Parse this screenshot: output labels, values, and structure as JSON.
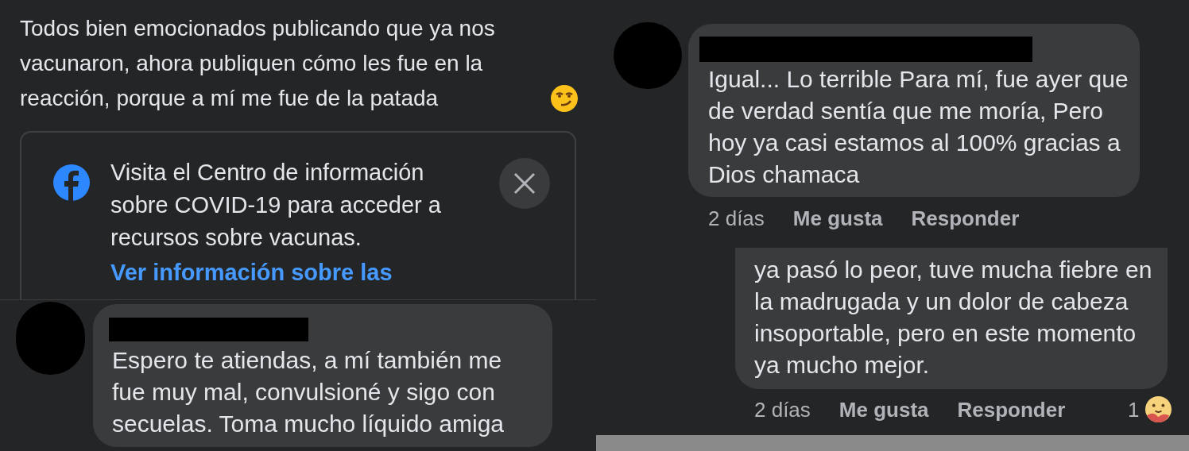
{
  "post": {
    "text": "Todos bien emocionados publicando que ya nos vacunaron, ahora publiquen cómo les fue en la reacción, porque a mí me fue de la patada"
  },
  "info_card": {
    "text": "Visita el Centro de información sobre COVID-19 para acceder a recursos sobre vacunas.",
    "link": "Ver información sobre las"
  },
  "left_comment": {
    "text": "Espero te atiendas, a mí también me fue muy mal, convulsioné y sigo con secuelas. Toma mucho líquido amiga"
  },
  "right_top_comment": {
    "text": "Igual... Lo terrible Para mí, fue ayer que de verdad sentía que me moría, Pero hoy ya casi estamos al 100% gracias a Dios chamaca",
    "time": "2 días",
    "like": "Me gusta",
    "reply": "Responder"
  },
  "right_bottom_comment": {
    "text": "ya pasó lo peor, tuve mucha fiebre en la madrugada y un dolor de cabeza insoportable, pero en este momento ya mucho mejor.",
    "time": "2 días",
    "like": "Me gusta",
    "reply": "Responder",
    "reaction_count": "1"
  }
}
